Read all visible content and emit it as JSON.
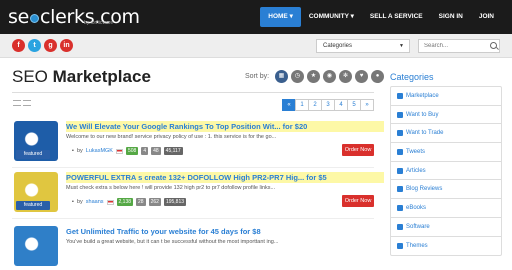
{
  "brand": {
    "logo_part1": "se",
    "logo_part2": "clerks",
    "logo_dotcom": ".com",
    "tagline": "by iomicware"
  },
  "nav": {
    "items": [
      {
        "label": "HOME ▾",
        "active": true
      },
      {
        "label": "COMMUNITY ▾",
        "active": false
      },
      {
        "label": "SELL A SERVICE",
        "active": false
      },
      {
        "label": "SIGN IN",
        "active": false
      },
      {
        "label": "JOIN",
        "active": false
      }
    ]
  },
  "subbar": {
    "social": [
      {
        "icon": "facebook-icon",
        "glyph": "f",
        "color": "#d9302c"
      },
      {
        "icon": "twitter-icon",
        "glyph": "t",
        "color": "#2aa3e0"
      },
      {
        "icon": "googleplus-icon",
        "glyph": "g",
        "color": "#d9302c"
      },
      {
        "icon": "linkedin-icon",
        "glyph": "in",
        "color": "#d9302c"
      }
    ],
    "categories_select": "Categories",
    "search_placeholder": "Search..."
  },
  "main": {
    "title_light": "SEO ",
    "title_bold": "Marketplace",
    "sort_label": "Sort by:",
    "sort_icons": [
      "grid-icon",
      "clock-icon",
      "star-icon",
      "eye-icon",
      "gear-icon",
      "heart-icon",
      "circle-icon"
    ],
    "pager": [
      "«",
      "1",
      "2",
      "3",
      "4",
      "5",
      "»"
    ]
  },
  "listings": [
    {
      "title": "We Will Elevate Your Google Rankings To Top Position Wit... for $20",
      "description": "Welcome to our new brand! service privacy policy of use : 1. this service is for the go...",
      "by": "by",
      "user": "LukasMGK",
      "stats": [
        "508",
        "4",
        "48",
        "45,117"
      ],
      "featured": "featured",
      "order": "Order Now",
      "highlight": true,
      "thumb_color": "#1e5da8"
    },
    {
      "title": "POWERFUL EXTRA s create 132+ DOFOLLOW High PR2-PR7 Hig... for $5",
      "description": "Must check extra s below here ! will provide 132 high pr2 to pr7 dofollow profile links...",
      "by": "by",
      "user": "shaans",
      "stats": [
        "2,138",
        "28",
        "262",
        "195,813"
      ],
      "featured": "featured",
      "order": "Order Now",
      "highlight": true,
      "thumb_color": "#e0c640"
    },
    {
      "title": "Get Unlimited Traffic to your website for 45 days for $8",
      "description": "You've build a great website, but it can t be successful without the most importtant ing...",
      "highlight": false,
      "thumb_color": "#2f7fc8"
    }
  ],
  "sidebar": {
    "title": "Categories",
    "items": [
      "Marketplace",
      "Want to Buy",
      "Want to Trade",
      "Tweets",
      "Articles",
      "Blog Reviews",
      "eBooks",
      "Software",
      "Themes"
    ]
  }
}
